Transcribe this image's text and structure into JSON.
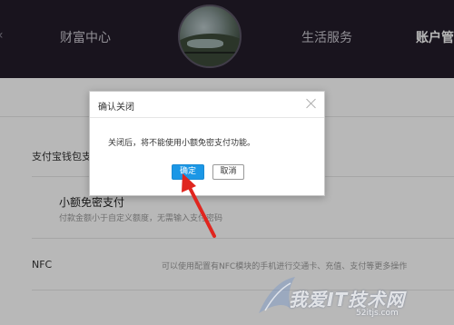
{
  "nav": {
    "items": [
      {
        "label": "财富中心"
      },
      {
        "label": "生活服务"
      },
      {
        "label": "账户管"
      }
    ],
    "left_edge_glyph": "‹"
  },
  "settings": {
    "wallet_label": "支付宝钱包支",
    "micro_pay": {
      "title": "小额免密支付",
      "desc": "付款金额小于自定义额度，无需输入支付密码"
    },
    "nfc": {
      "label": "NFC",
      "desc": "可以使用配置有NFC模块的手机进行交通卡、充值、支付等更多操作"
    }
  },
  "dialog": {
    "title": "确认关闭",
    "message": "关闭后，将不能使用小额免密支付功能。",
    "ok_label": "确定",
    "cancel_label": "取消",
    "close_icon": "close-icon"
  },
  "watermark": {
    "text": "我爱IT技术网",
    "url": "52itjs.com"
  },
  "colors": {
    "topbar": "#231d2a",
    "primary_button": "#1b97e6",
    "annotation_arrow": "#e0261f"
  }
}
